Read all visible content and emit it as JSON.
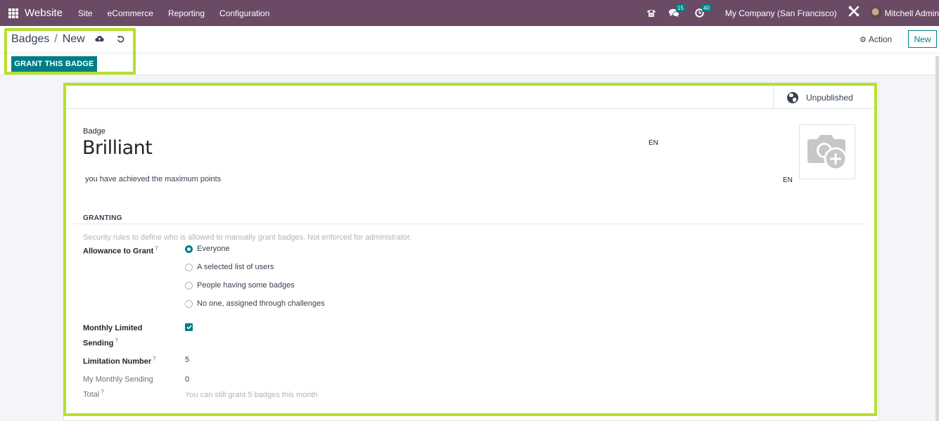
{
  "navbar": {
    "app_name": "Website",
    "menu": [
      "Site",
      "eCommerce",
      "Reporting",
      "Configuration"
    ],
    "icons": {
      "apps": "apps-grid-icon",
      "phone": "phone-icon",
      "messages": "chat-icon",
      "activities": "clock-icon",
      "debug": "tools-icon"
    },
    "messages_count": "15",
    "activities_count": "40",
    "company": "My Company (San Francisco)",
    "user": "Mitchell Admin"
  },
  "control_panel": {
    "breadcrumb_parent": "Badges",
    "breadcrumb_separator": "/",
    "breadcrumb_current": "New",
    "grant_button": "GRANT THIS BADGE",
    "action_label": "Action",
    "new_label": "New"
  },
  "colors": {
    "navbar": "#6b4a66",
    "primary": "#017e84",
    "highlight": "#b6e12b"
  },
  "form": {
    "publish_status": "Unpublished",
    "badge_label": "Badge",
    "badge_name": "Brilliant",
    "name_lang": "EN",
    "description": "you have achieved the maximum points",
    "description_lang": "EN",
    "granting": {
      "title": "GRANTING",
      "help": "Security rules to define who is allowed to manually grant badges. Not enforced for administrator.",
      "allowance_label": "Allowance to Grant",
      "tooltip_mark": "?",
      "options": [
        {
          "label": "Everyone",
          "checked": true
        },
        {
          "label": "A selected list of users",
          "checked": false
        },
        {
          "label": "People having some badges",
          "checked": false
        },
        {
          "label": "No one, assigned through challenges",
          "checked": false
        }
      ],
      "monthly_limited_label_1": "Monthly Limited",
      "monthly_limited_label_2": "Sending",
      "monthly_limited_checked": true,
      "limitation_label": "Limitation Number",
      "limitation_value": "5",
      "monthly_total_label_1": "My Monthly Sending",
      "monthly_total_label_2": "Total",
      "monthly_total_value": "0",
      "remaining_text": "You can still grant 5 badges this month"
    }
  }
}
